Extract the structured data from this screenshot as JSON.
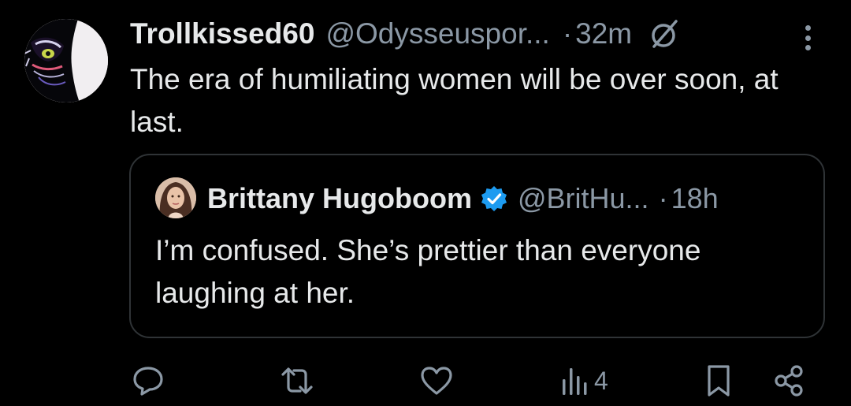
{
  "tweet": {
    "author_name": "Trollkissed60",
    "author_handle": "@Odysseuspor...",
    "separator": "·",
    "time": "32m",
    "text": "The era of humiliating women will be over soon, at last."
  },
  "quote": {
    "author_name": "Brittany Hugoboom",
    "author_handle": "@BritHu...",
    "separator": "·",
    "time": "18h",
    "text": "I’m confused. She’s prettier than everyone laughing at her."
  },
  "actions": {
    "views_count": "4"
  },
  "icons": [
    "avatar",
    "grok-icon",
    "more-icon",
    "verified-icon",
    "reply-icon",
    "retweet-icon",
    "like-icon",
    "views-icon",
    "bookmark-icon",
    "share-icon"
  ],
  "colors": {
    "background": "#000000",
    "text_primary": "#e7e9ea",
    "text_secondary": "#8b98a5",
    "border": "#2f3336",
    "verified": "#1d9bf0"
  }
}
